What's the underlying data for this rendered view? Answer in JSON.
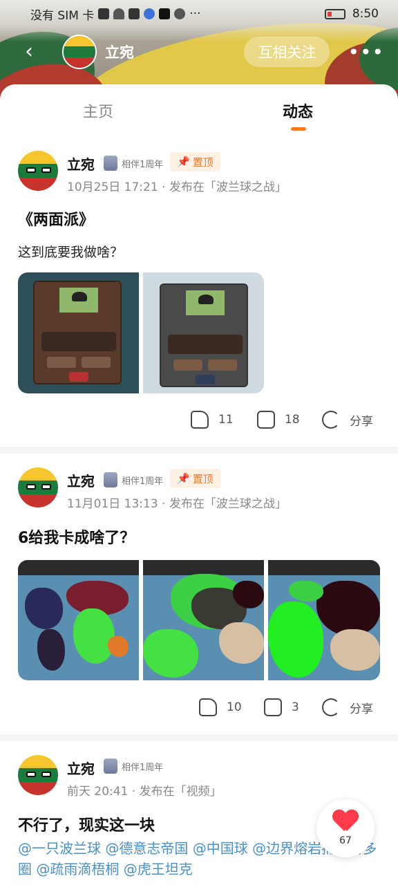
{
  "status_bar": {
    "carrier": "没有 SIM 卡",
    "time": "8:50"
  },
  "header": {
    "back_icon": "chevron-left-icon",
    "user_name": "立宛",
    "follow_label": "互相关注",
    "more_icon": "more-dots-icon"
  },
  "tabs": [
    {
      "label": "主页",
      "active": false
    },
    {
      "label": "动态",
      "active": true
    }
  ],
  "posts": [
    {
      "author": "立宛",
      "badge": "相伴1周年",
      "pinned": "置顶",
      "meta": "10月25日 17:21 · 发布在「波兰球之战」",
      "title": "《两面派》",
      "body": "这到底要我做啥？",
      "likes": "11",
      "comments": "18",
      "share": "分享"
    },
    {
      "author": "立宛",
      "badge": "相伴1周年",
      "pinned": "置顶",
      "meta": "11月01日 13:13 · 发布在「波兰球之战」",
      "title": "6给我卡成啥了？",
      "likes": "10",
      "comments": "3",
      "share": "分享"
    },
    {
      "author": "立宛",
      "badge": "相伴1周年",
      "meta": "前天 20:41 · 发布在「视频」",
      "title": "不行了，现实这一块",
      "mentions": "@一只波兰球 @德意志帝国 @中国球 @边界熔岩捕食者多圈 @疏雨滴梧桐 @虎王坦克"
    }
  ],
  "like_fab": {
    "count": "67"
  },
  "colors": {
    "accent": "#ff7a1a",
    "link": "#4a90c8",
    "heart": "#ff3b4c"
  }
}
